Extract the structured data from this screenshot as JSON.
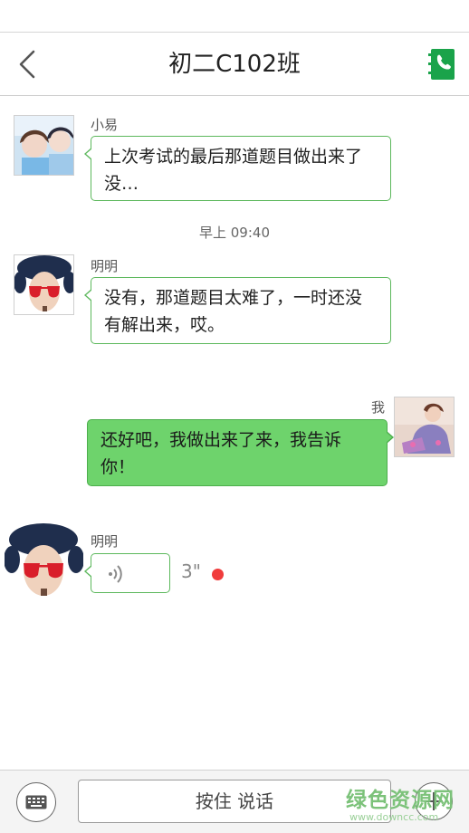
{
  "header": {
    "title": "初二C102班",
    "back_icon": "chevron-left-icon",
    "contacts_icon": "contacts-book-icon",
    "accent_color": "#1aa34a"
  },
  "messages": [
    {
      "sender": "小易",
      "direction": "in",
      "type": "text",
      "text": "上次考试的最后那道题目做出来了没…"
    },
    {
      "type": "timestamp",
      "text": "早上 09:40"
    },
    {
      "sender": "明明",
      "direction": "in",
      "type": "text",
      "text": "没有，那道题目太难了，一时还没有解出来，哎。"
    },
    {
      "sender": "我",
      "direction": "out",
      "type": "text",
      "text": "还好吧，我做出来了来，我告诉你！"
    },
    {
      "sender": "明明",
      "direction": "in",
      "type": "voice",
      "duration": "3\"",
      "unread": true,
      "icon": "voice-wave-icon"
    }
  ],
  "input_bar": {
    "keyboard_icon": "keyboard-icon",
    "hold_to_talk_label": "按住 说话",
    "plus_icon": "plus-icon"
  },
  "watermark": {
    "main": "绿色资源网",
    "sub": "www.downcc.com"
  },
  "colors": {
    "incoming_border": "#5cb85c",
    "outgoing_bubble": "#6ed36c",
    "unread_dot": "#f03c3c"
  }
}
